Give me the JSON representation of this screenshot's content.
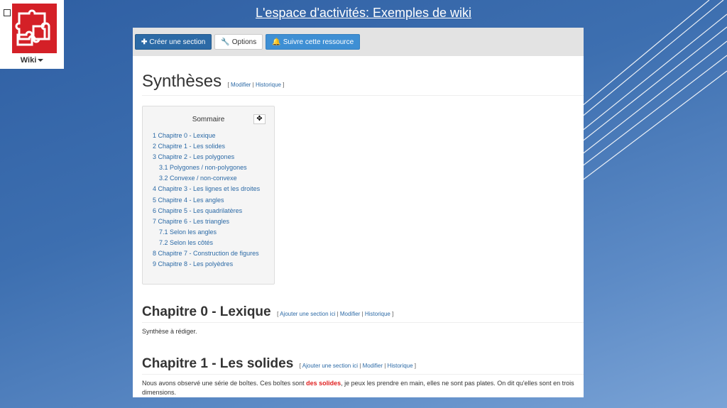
{
  "slide": {
    "title": "L'espace d'activités: Exemples de wiki"
  },
  "logo": {
    "menu_label": "Wiki"
  },
  "toolbar": {
    "create_section": "Créer une section",
    "options": "Options",
    "follow": "Suivre cette ressource"
  },
  "page": {
    "title": "Synthèses",
    "links": {
      "edit": "Modifier",
      "history": "Historique"
    }
  },
  "toc": {
    "title": "Sommaire",
    "items": [
      "1 Chapitre 0 - Lexique",
      "2 Chapitre 1 - Les solides",
      "3 Chapitre 2 - Les polygones",
      "3.1 Polygones / non-polygones",
      "3.2 Convexe / non-convexe",
      "4 Chapitre 3 - Les lignes et les droites",
      "5 Chapitre 4 - Les angles",
      "6 Chapitre 5 - Les quadrilatères",
      "7 Chapitre 6 - Les triangles",
      "7.1 Selon les angles",
      "7.2 Selon les côtés",
      "8 Chapitre 7 - Construction de figures",
      "9 Chapitre 8 - Les polyèdres"
    ]
  },
  "section_links": {
    "add": "Ajouter une section ici",
    "edit": "Modifier",
    "history": "Historique"
  },
  "sections": [
    {
      "title": "Chapitre 0 - Lexique",
      "text": "Synthèse à rédiger."
    },
    {
      "title": "Chapitre 1 - Les solides",
      "text_before": "Nous avons observé une série de boîtes. Ces boîtes sont ",
      "highlight": "des solides",
      "text_after": ", je peux les prendre en main, elles ne sont pas plates. On dit qu'elles sont en trois dimensions."
    }
  ],
  "colors": {
    "primary": "#2c6aa6",
    "info": "#3e8fd4",
    "logo_red": "#d42027",
    "highlight": "#e02020"
  }
}
